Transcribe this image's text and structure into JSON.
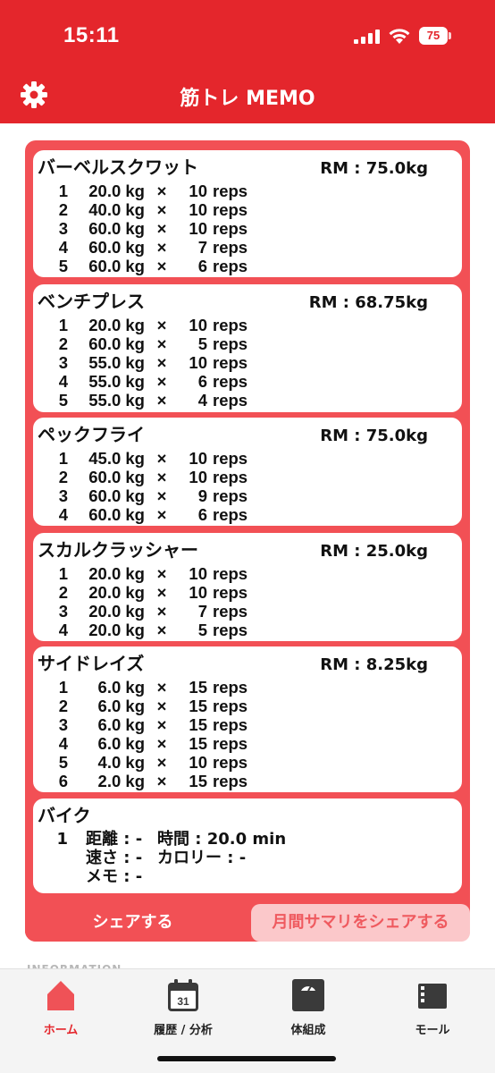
{
  "status": {
    "time": "15:11",
    "battery": "75"
  },
  "header": {
    "title": "筋トレ MEMO"
  },
  "exercises": [
    {
      "name": "バーベルスクワット",
      "rm": "RM : 75.0kg",
      "sets": [
        {
          "idx": "1",
          "weight": "20.0 kg",
          "x": "×",
          "reps": "10",
          "unit": "reps"
        },
        {
          "idx": "2",
          "weight": "40.0 kg",
          "x": "×",
          "reps": "10",
          "unit": "reps"
        },
        {
          "idx": "3",
          "weight": "60.0 kg",
          "x": "×",
          "reps": "10",
          "unit": "reps"
        },
        {
          "idx": "4",
          "weight": "60.0 kg",
          "x": "×",
          "reps": "7",
          "unit": "reps"
        },
        {
          "idx": "5",
          "weight": "60.0 kg",
          "x": "×",
          "reps": "6",
          "unit": "reps"
        }
      ]
    },
    {
      "name": "ベンチプレス",
      "rm": "RM : 68.75kg",
      "sets": [
        {
          "idx": "1",
          "weight": "20.0 kg",
          "x": "×",
          "reps": "10",
          "unit": "reps"
        },
        {
          "idx": "2",
          "weight": "60.0 kg",
          "x": "×",
          "reps": "5",
          "unit": "reps"
        },
        {
          "idx": "3",
          "weight": "55.0 kg",
          "x": "×",
          "reps": "10",
          "unit": "reps"
        },
        {
          "idx": "4",
          "weight": "55.0 kg",
          "x": "×",
          "reps": "6",
          "unit": "reps"
        },
        {
          "idx": "5",
          "weight": "55.0 kg",
          "x": "×",
          "reps": "4",
          "unit": "reps"
        }
      ]
    },
    {
      "name": "ペックフライ",
      "rm": "RM : 75.0kg",
      "sets": [
        {
          "idx": "1",
          "weight": "45.0 kg",
          "x": "×",
          "reps": "10",
          "unit": "reps"
        },
        {
          "idx": "2",
          "weight": "60.0 kg",
          "x": "×",
          "reps": "10",
          "unit": "reps"
        },
        {
          "idx": "3",
          "weight": "60.0 kg",
          "x": "×",
          "reps": "9",
          "unit": "reps"
        },
        {
          "idx": "4",
          "weight": "60.0 kg",
          "x": "×",
          "reps": "6",
          "unit": "reps"
        }
      ]
    },
    {
      "name": "スカルクラッシャー",
      "rm": "RM : 25.0kg",
      "sets": [
        {
          "idx": "1",
          "weight": "20.0 kg",
          "x": "×",
          "reps": "10",
          "unit": "reps"
        },
        {
          "idx": "2",
          "weight": "20.0 kg",
          "x": "×",
          "reps": "10",
          "unit": "reps"
        },
        {
          "idx": "3",
          "weight": "20.0 kg",
          "x": "×",
          "reps": "7",
          "unit": "reps"
        },
        {
          "idx": "4",
          "weight": "20.0 kg",
          "x": "×",
          "reps": "5",
          "unit": "reps"
        }
      ]
    },
    {
      "name": "サイドレイズ",
      "rm": "RM : 8.25kg",
      "sets": [
        {
          "idx": "1",
          "weight": "6.0 kg",
          "x": "×",
          "reps": "15",
          "unit": "reps"
        },
        {
          "idx": "2",
          "weight": "6.0 kg",
          "x": "×",
          "reps": "15",
          "unit": "reps"
        },
        {
          "idx": "3",
          "weight": "6.0 kg",
          "x": "×",
          "reps": "15",
          "unit": "reps"
        },
        {
          "idx": "4",
          "weight": "6.0 kg",
          "x": "×",
          "reps": "15",
          "unit": "reps"
        },
        {
          "idx": "5",
          "weight": "4.0 kg",
          "x": "×",
          "reps": "10",
          "unit": "reps"
        },
        {
          "idx": "6",
          "weight": "2.0 kg",
          "x": "×",
          "reps": "15",
          "unit": "reps"
        }
      ]
    }
  ],
  "cardio": {
    "name": "バイク",
    "idx": "1",
    "distance": "距離 : -",
    "time": "時間 : 20.0 min",
    "speed": "速さ : -",
    "calories": "カロリー : -",
    "memo": "メモ : -"
  },
  "actions": {
    "share": "シェアする",
    "monthly_share": "月間サマリをシェアする"
  },
  "info_peek": "INFORMATION",
  "tabs": [
    {
      "label": "ホーム",
      "icon": "home-icon",
      "active": true
    },
    {
      "label": "履歴 / 分析",
      "icon": "calendar-icon",
      "calendar_day": "31"
    },
    {
      "label": "体組成",
      "icon": "scale-icon"
    },
    {
      "label": "モール",
      "icon": "store-icon"
    }
  ],
  "colors": {
    "brand": "#e4262c",
    "panel": "#f25055",
    "monthly_button_bg": "#fbc8ca"
  }
}
